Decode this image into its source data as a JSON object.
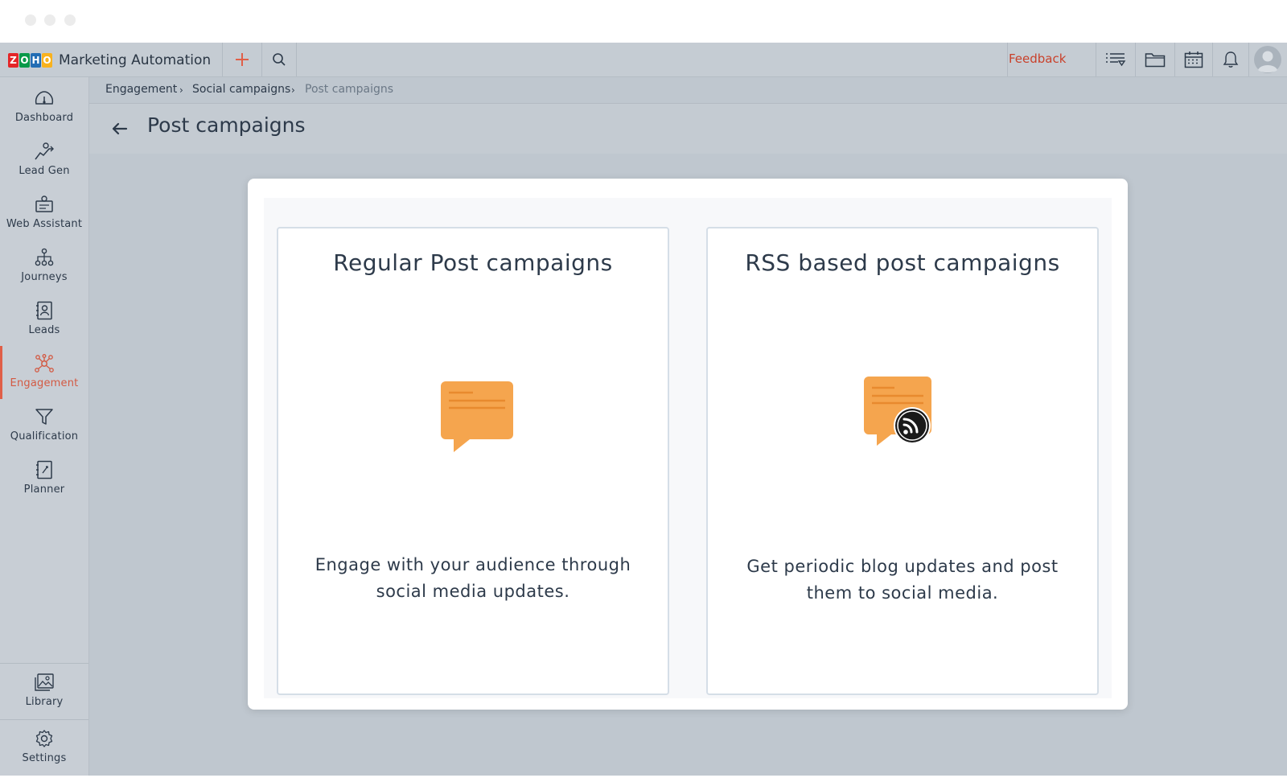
{
  "window": {
    "controls": [
      "close",
      "minimize",
      "maximize"
    ]
  },
  "topnav": {
    "logo_letters": [
      "Z",
      "O",
      "H",
      "O"
    ],
    "logo_colors": [
      "#e42527",
      "#089949",
      "#226db4",
      "#f9b21d"
    ],
    "app_name": "Marketing Automation",
    "feedback_label": "Feedback",
    "accent_color": "#e05f48"
  },
  "sidebar": {
    "items": [
      {
        "label": "Dashboard",
        "icon": "dashboard-icon"
      },
      {
        "label": "Lead Gen",
        "icon": "lead-gen-icon"
      },
      {
        "label": "Web Assistant",
        "icon": "web-assistant-icon"
      },
      {
        "label": "Journeys",
        "icon": "journeys-icon"
      },
      {
        "label": "Leads",
        "icon": "leads-icon"
      },
      {
        "label": "Engagement",
        "icon": "engagement-icon",
        "active": true
      },
      {
        "label": "Qualification",
        "icon": "qualification-icon"
      },
      {
        "label": "Planner",
        "icon": "planner-icon"
      }
    ],
    "bottom_items": [
      {
        "label": "Library",
        "icon": "library-icon"
      },
      {
        "label": "Settings",
        "icon": "settings-icon"
      }
    ]
  },
  "breadcrumb": [
    "Engagement",
    "Social campaigns",
    "Post campaigns"
  ],
  "page": {
    "title": "Post campaigns"
  },
  "cards": [
    {
      "title": "Regular Post campaigns",
      "description": "Engage with your audience through social media updates.",
      "icon": "chat-bubble-icon"
    },
    {
      "title": "RSS based post campaigns",
      "description": "Get periodic blog updates and post them to social media.",
      "icon": "rss-chat-bubble-icon"
    }
  ],
  "colors": {
    "bubble": "#f5a54e",
    "bubble_lines": "#e88a2e",
    "active_nav": "#d35a43"
  }
}
